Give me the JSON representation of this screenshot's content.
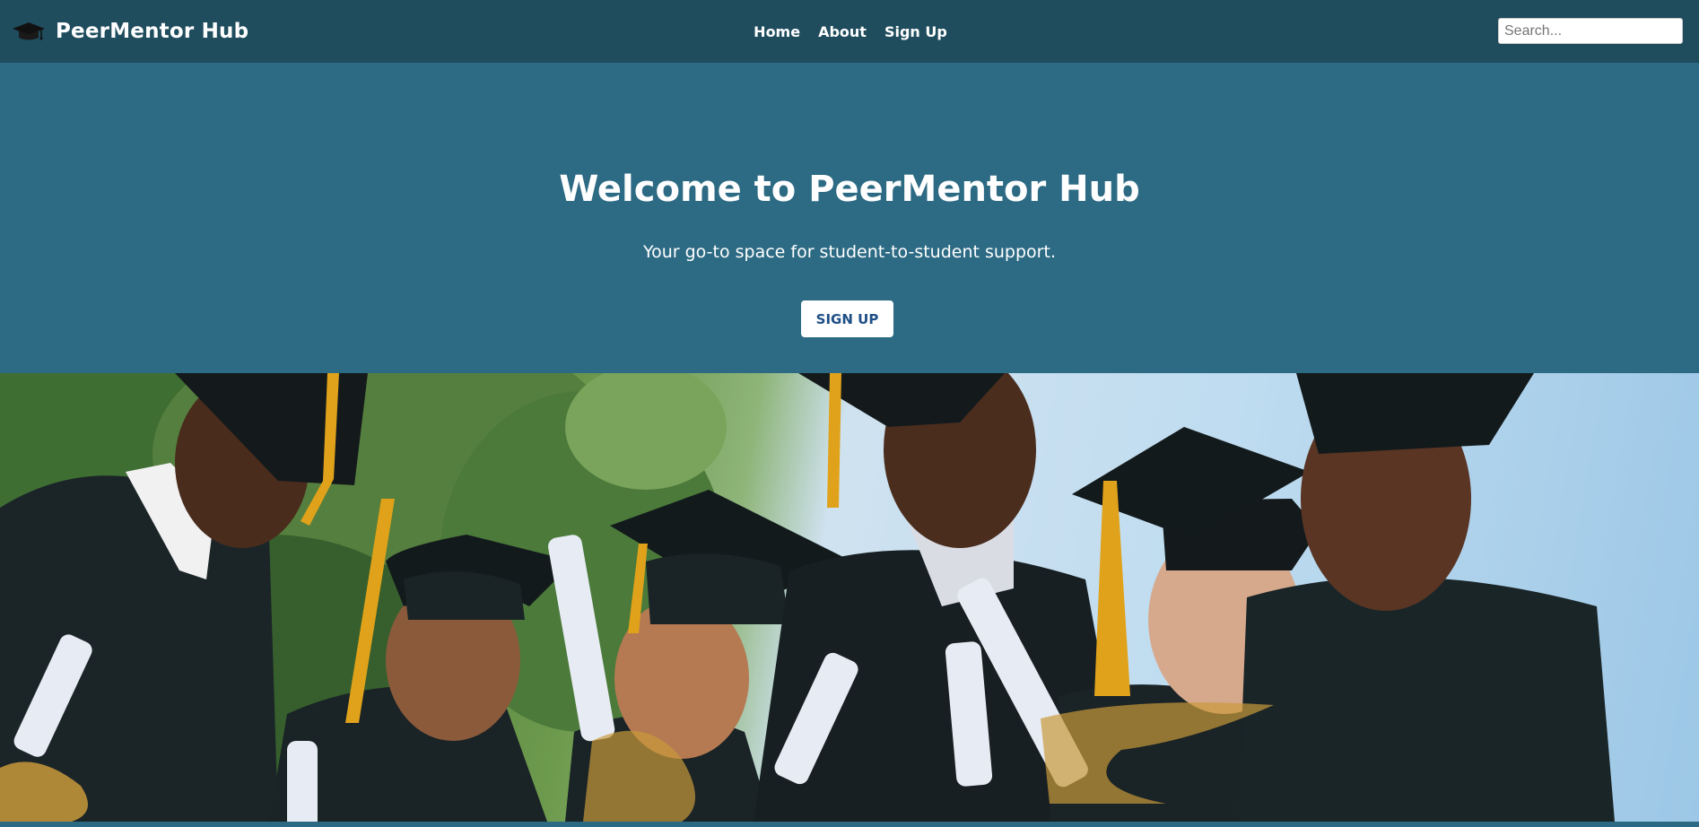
{
  "header": {
    "brand": "PeerMentor Hub",
    "brand_icon": "graduation-cap-icon",
    "nav": [
      {
        "label": "Home"
      },
      {
        "label": "About"
      },
      {
        "label": "Sign Up"
      }
    ],
    "search_placeholder": "Search..."
  },
  "hero": {
    "title": "Welcome to PeerMentor Hub",
    "subtitle": "Your go-to space for student-to-student support.",
    "cta_label": "SIGN UP"
  },
  "photo": {
    "subject": "graduates-group-photo"
  },
  "colors": {
    "navbar": "#1f4d5e",
    "hero": "#2d6b84",
    "button_text": "#1e4f86"
  }
}
